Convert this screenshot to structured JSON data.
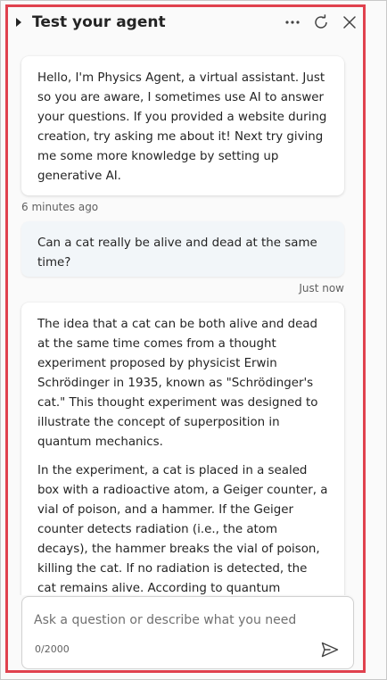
{
  "header": {
    "title": "Test your agent",
    "icons": [
      "caret-right-icon",
      "more-options-icon",
      "refresh-icon",
      "close-icon"
    ]
  },
  "messages": [
    {
      "role": "bot",
      "paragraphs": [
        "Hello, I'm Physics Agent, a virtual assistant. Just so you are aware, I sometimes use AI to answer your questions. If you provided a website during creation, try asking me about it! Next try giving me some more knowledge by setting up generative AI."
      ],
      "timestamp": "6 minutes ago"
    },
    {
      "role": "user",
      "paragraphs": [
        "Can a cat really be alive and dead at the same time?"
      ],
      "timestamp": "Just now"
    },
    {
      "role": "bot",
      "paragraphs": [
        "The idea that a cat can be both alive and dead at the same time comes from a thought experiment proposed by physicist Erwin Schrödinger in 1935, known as \"Schrödinger's cat.\" This thought experiment was designed to illustrate the concept of superposition in quantum mechanics.",
        "In the experiment, a cat is placed in a sealed box with a radioactive atom, a Geiger counter, a vial of poison, and a hammer. If the Geiger counter detects radiation (i.e., the atom decays), the hammer breaks the vial of poison, killing the cat. If no radiation is detected, the cat remains alive. According to quantum"
      ]
    }
  ],
  "composer": {
    "placeholder": "Ask a question or describe what you need",
    "counter": "0/2000",
    "send_icon": "send-icon"
  },
  "colors": {
    "highlight_border": "#e0414e",
    "user_bubble": "#f2f6f9",
    "bot_bubble": "#ffffff",
    "panel_background": "#fafafa"
  }
}
